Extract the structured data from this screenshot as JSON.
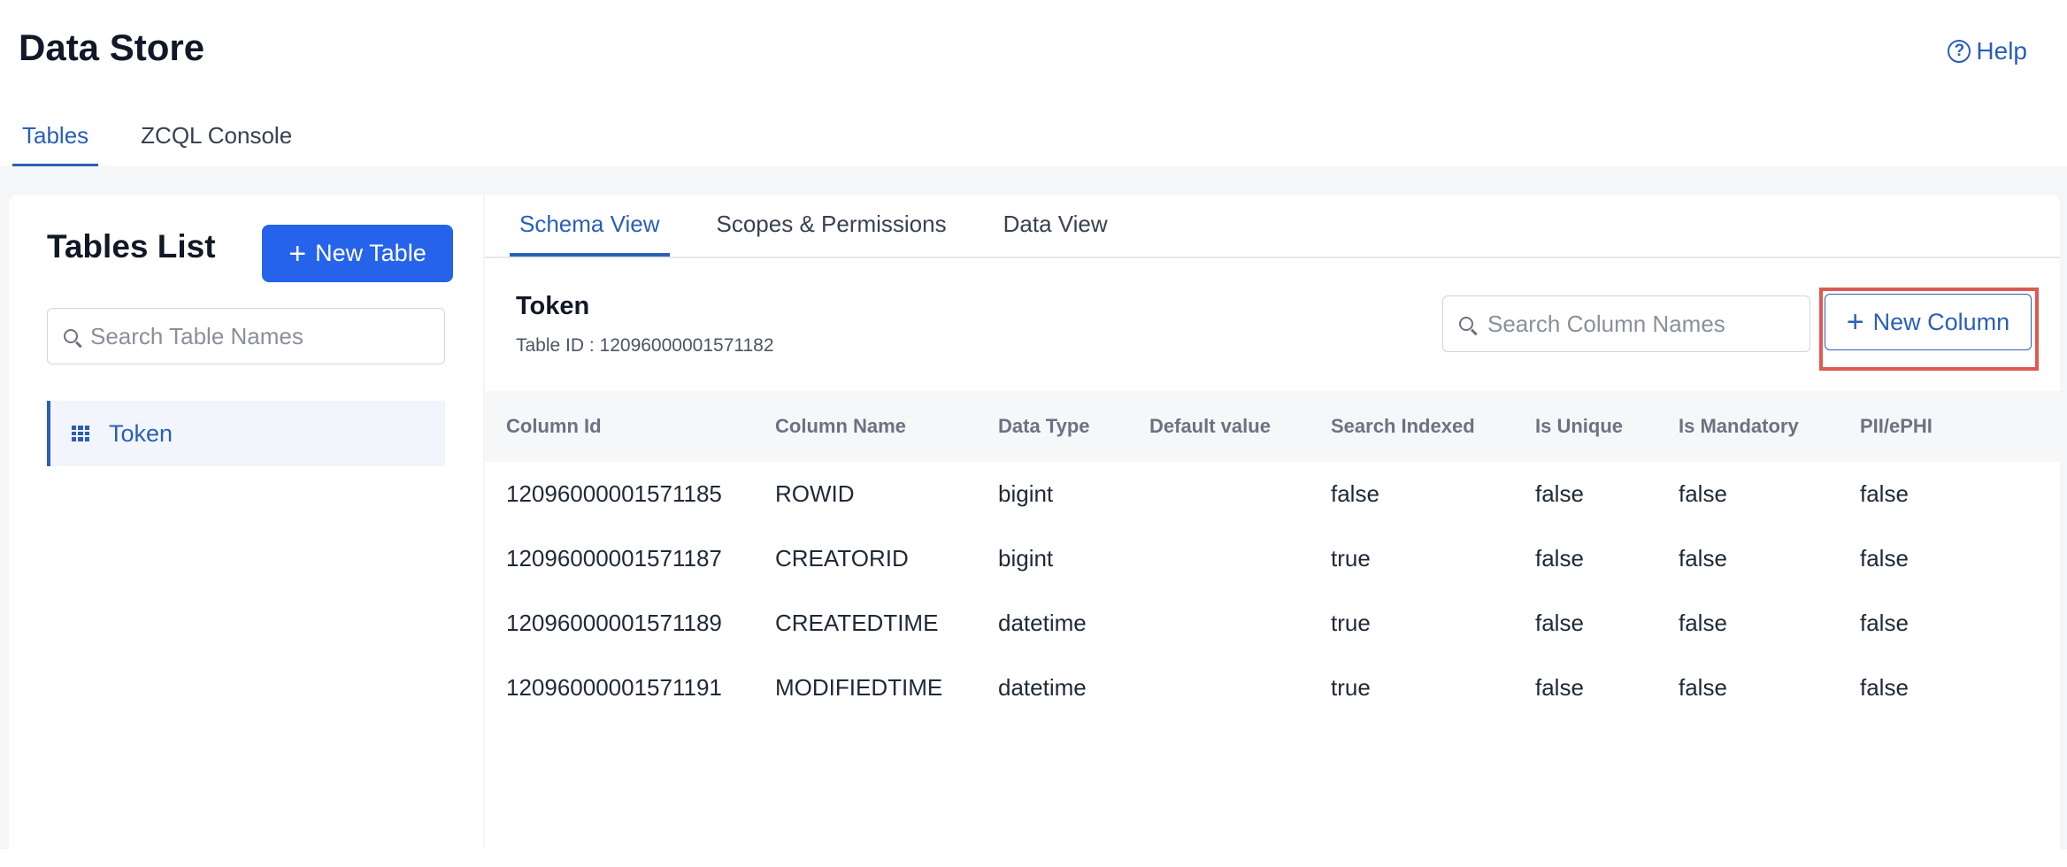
{
  "header": {
    "title": "Data Store",
    "help_label": "Help",
    "help_icon": "question-circle-icon"
  },
  "top_tabs": [
    {
      "label": "Tables",
      "active": true
    },
    {
      "label": "ZCQL Console",
      "active": false
    }
  ],
  "sidebar": {
    "title": "Tables List",
    "new_table_label": "New Table",
    "search_placeholder": "Search Table Names",
    "tables": [
      {
        "label": "Token",
        "icon": "table-grid-icon",
        "selected": true
      }
    ]
  },
  "main": {
    "tabs": [
      {
        "label": "Schema View",
        "active": true
      },
      {
        "label": "Scopes & Permissions",
        "active": false
      },
      {
        "label": "Data View",
        "active": false
      }
    ],
    "table_name": "Token",
    "table_id": "Table ID : 12096000001571182",
    "search_placeholder": "Search Column Names",
    "new_column_label": "New Column",
    "columns": {
      "headers": [
        "Column Id",
        "Column Name",
        "Data Type",
        "Default value",
        "Search Indexed",
        "Is Unique",
        "Is Mandatory",
        "PII/ePHI"
      ],
      "rows": [
        [
          "12096000001571185",
          "ROWID",
          "bigint",
          "",
          "false",
          "false",
          "false",
          "false"
        ],
        [
          "12096000001571187",
          "CREATORID",
          "bigint",
          "",
          "true",
          "false",
          "false",
          "false"
        ],
        [
          "12096000001571189",
          "CREATEDTIME",
          "datetime",
          "",
          "true",
          "false",
          "false",
          "false"
        ],
        [
          "12096000001571191",
          "MODIFIEDTIME",
          "datetime",
          "",
          "true",
          "false",
          "false",
          "false"
        ]
      ]
    }
  },
  "colors": {
    "accent": "#2a5fb8",
    "primary_button": "#2563eb",
    "highlight_border": "#dc5a52"
  }
}
